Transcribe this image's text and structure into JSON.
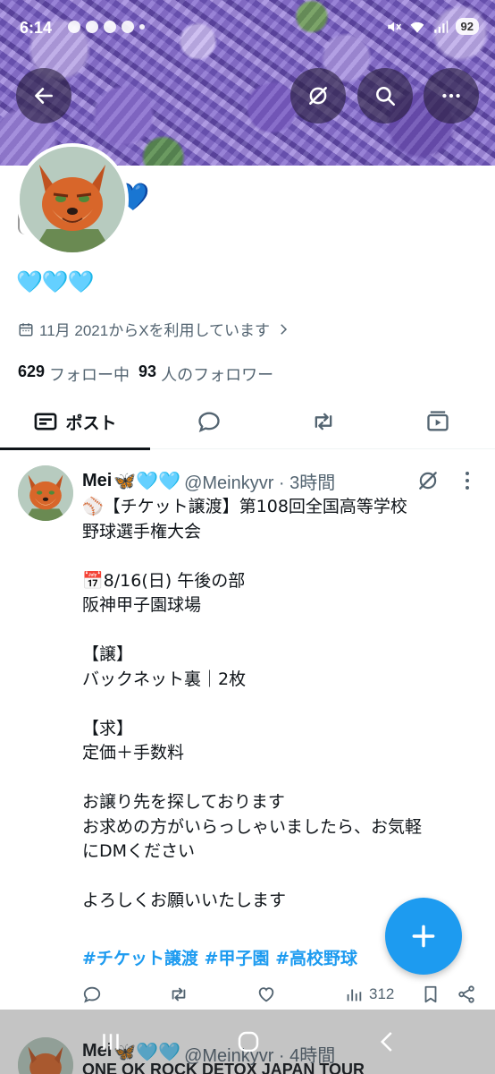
{
  "status_bar": {
    "time": "6:14",
    "battery": "92"
  },
  "profile": {
    "name_hearts": "💙",
    "bio_hearts": "🩵🩵🩵",
    "joined": "11月 2021からXを利用しています",
    "following_count": "629",
    "following_label": "フォロー中",
    "followers_count": "93",
    "followers_label": "人のフォロワー"
  },
  "tabs": {
    "posts_label": "ポスト"
  },
  "post": {
    "name": "Mei",
    "name_emojis": "🦋🩵🩵",
    "handle_time": "@Meinkyvr · 3時間",
    "body": "⚾【チケット譲渡】第108回全国高等学校\n野球選手権大会\n\n📅8/16(日) 午後の部\n阪神甲子園球場\n\n【譲】\nバックネット裏｜2枚\n\n【求】\n定価＋手数料\n\nお譲り先を探しております\nお求めの方がいらっしゃいましたら、お気軽\nにDMください\n\nよろしくお願いいたします",
    "hashtags": "#チケット譲渡 #甲子園 #高校野球",
    "views": "312"
  },
  "post2": {
    "name": "Mei",
    "name_emojis": "🦋🩵🩵",
    "handle_time": "@Meinkyvr · 4時間",
    "preview": "ONE OK ROCK DETOX JAPAN TOUR"
  },
  "colors": {
    "accent": "#1d9bf0",
    "text_secondary": "#536471",
    "heart": "#33d0e8"
  }
}
